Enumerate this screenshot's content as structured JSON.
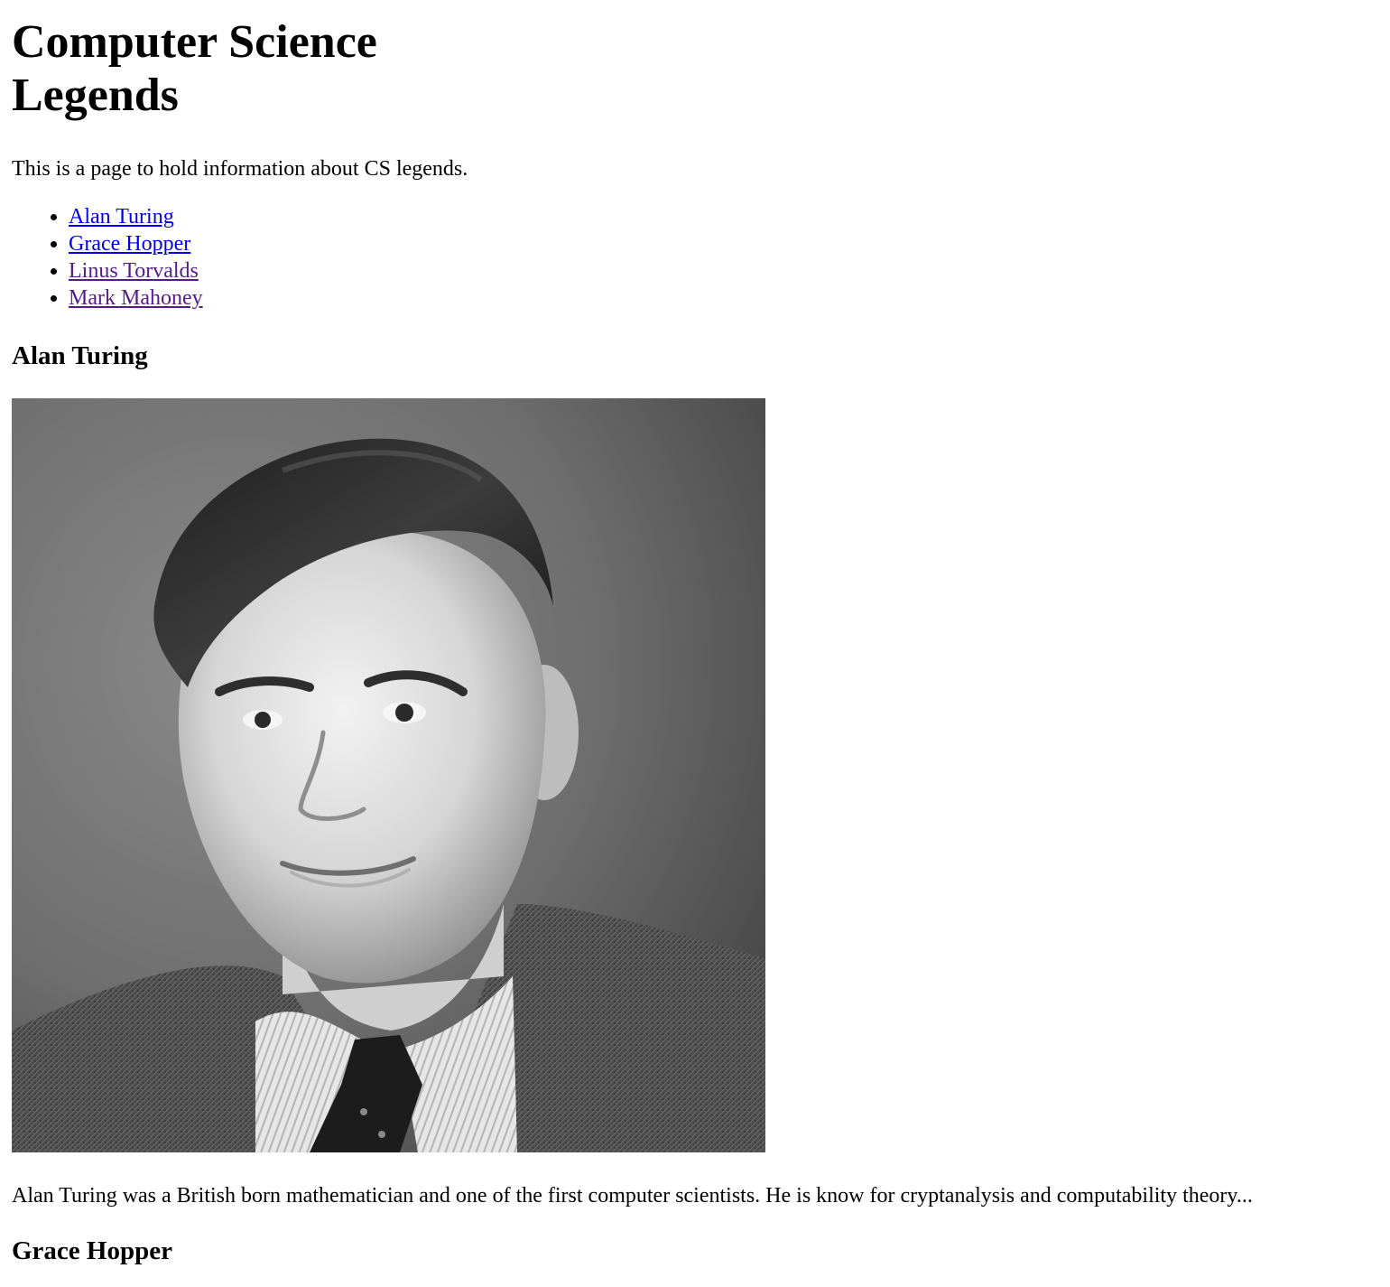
{
  "page": {
    "title": "Computer Science Legends",
    "intro": "This is a page to hold information about CS legends."
  },
  "nav": {
    "links": [
      {
        "label": "Alan Turing",
        "state": "unvisited"
      },
      {
        "label": "Grace Hopper",
        "state": "unvisited"
      },
      {
        "label": "Linus Torvalds",
        "state": "visited"
      },
      {
        "label": "Mark Mahoney",
        "state": "visited"
      }
    ]
  },
  "sections": [
    {
      "heading": "Alan Turing",
      "image": "portrait-photo",
      "bio": "Alan Turing was a British born mathematician and one of the first computer scientists. He is know for cryptanalysis and computability theory..."
    },
    {
      "heading": "Grace Hopper"
    }
  ],
  "colors": {
    "link": "#0000ee",
    "visited_link": "#551a8b",
    "text": "#000000",
    "background": "#ffffff"
  }
}
